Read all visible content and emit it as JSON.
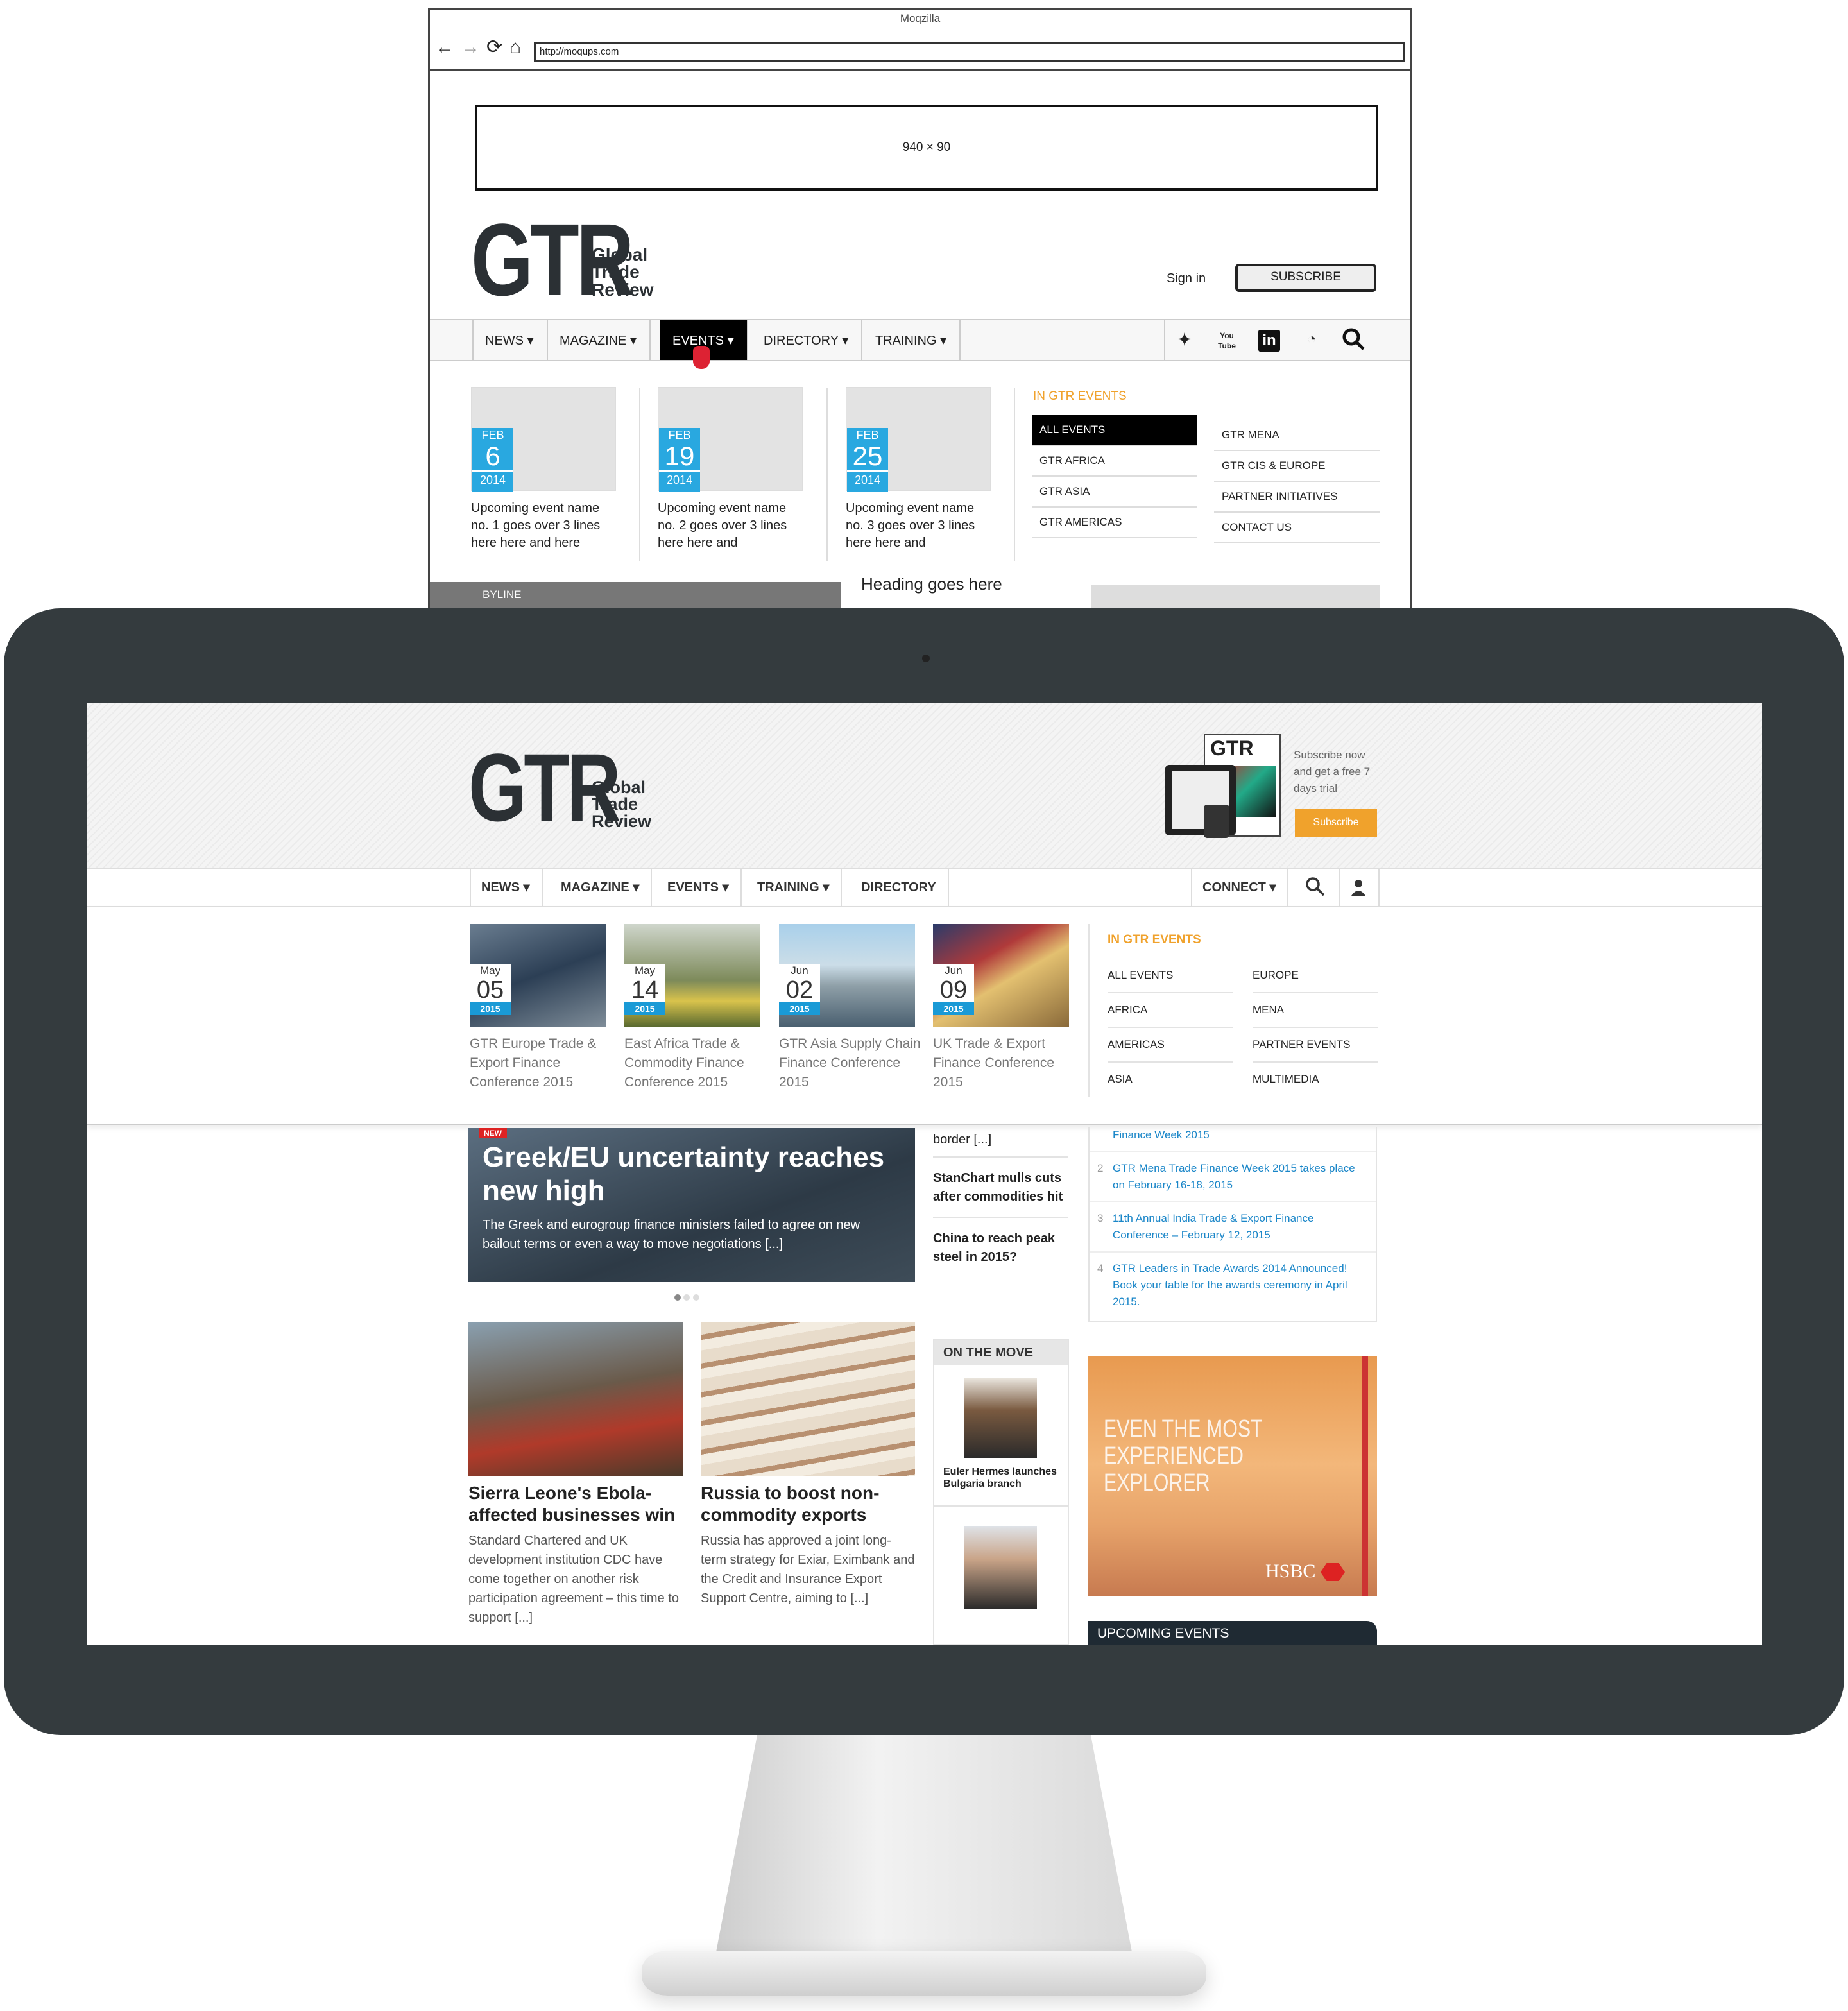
{
  "wireframe": {
    "window_title": "Moqzilla",
    "url": "http://moqups.com",
    "banner_label": "940 × 90",
    "logo": {
      "mark": "GTR",
      "line1": "Global",
      "line2": "Trade",
      "line3": "Review"
    },
    "sign_in": "Sign in",
    "subscribe": "SUBSCRIBE",
    "nav": [
      "NEWS ▾",
      "MAGAZINE ▾",
      "EVENTS ▾",
      "DIRECTORY ▾",
      "TRAINING ▾"
    ],
    "social_icons": [
      "twitter-icon",
      "youtube-icon",
      "linkedin-icon",
      "rss-icon",
      "search-icon"
    ],
    "youtube_label": "You Tube",
    "linkedin_label": "in",
    "cards": [
      {
        "month": "FEB",
        "day": "6",
        "year": "2014",
        "text": "Upcoming event name no. 1 goes over 3 lines here here and here"
      },
      {
        "month": "FEB",
        "day": "19",
        "year": "2014",
        "text": "Upcoming event name no. 2 goes over 3 lines here here and"
      },
      {
        "month": "FEB",
        "day": "25",
        "year": "2014",
        "text": "Upcoming event name no. 3 goes over 3 lines here here and"
      }
    ],
    "section_title": "IN GTR EVENTS",
    "events_col1": [
      "ALL EVENTS",
      "GTR AFRICA",
      "GTR ASIA",
      "GTR AMERICAS"
    ],
    "events_col2": [
      "GTR MENA",
      "GTR CIS & EUROPE",
      "PARTNER INITIATIVES",
      "CONTACT US"
    ],
    "byline": "BYLINE",
    "partial_heading": "Heading goes here"
  },
  "site": {
    "logo": {
      "mark": "GTR",
      "line1": "Global",
      "line2": "Trade",
      "line3": "Review"
    },
    "promo_text": "Subscribe now and get a free 7 days trial",
    "promo_button": "Subscribe",
    "nav": [
      "NEWS ▾",
      "MAGAZINE ▾",
      "EVENTS ▾",
      "TRAINING ▾",
      "DIRECTORY"
    ],
    "connect": "CONNECT ▾",
    "cards": [
      {
        "month": "May",
        "day": "05",
        "year": "2015",
        "text": "GTR Europe Trade & Export Finance Conference 2015"
      },
      {
        "month": "May",
        "day": "14",
        "year": "2015",
        "text": "East Africa Trade & Commodity Finance Conference 2015"
      },
      {
        "month": "Jun",
        "day": "02",
        "year": "2015",
        "text": "GTR Asia Supply Chain Finance Conference 2015"
      },
      {
        "month": "Jun",
        "day": "09",
        "year": "2015",
        "text": "UK Trade & Export Finance Conference 2015"
      }
    ],
    "section_title": "IN GTR EVENTS",
    "events_col1": [
      "ALL EVENTS",
      "AFRICA",
      "AMERICAS",
      "ASIA"
    ],
    "events_col2": [
      "EUROPE",
      "MENA",
      "PARTNER EVENTS",
      "MULTIMEDIA"
    ],
    "hero": {
      "badge": "NEW",
      "title": "Greek/EU uncertainty reaches new high",
      "text": "The Greek and eurogroup finance ministers failed to agree on new bailout terms or even a way to move negotiations [...]"
    },
    "side_stories": [
      {
        "title": "border [...]"
      },
      {
        "title": "StanChart mulls cuts after commodities hit"
      },
      {
        "title": "China to reach peak steel in 2015?"
      }
    ],
    "numbered": [
      {
        "n": "",
        "text": "Finance Week 2015"
      },
      {
        "n": "2",
        "text": "GTR Mena Trade Finance Week 2015 takes place on February 16-18, 2015"
      },
      {
        "n": "3",
        "text": "11th Annual India Trade & Export Finance Conference – February 12, 2015"
      },
      {
        "n": "4",
        "text": "GTR Leaders in Trade Awards 2014 Announced! Book your table for the awards ceremony in April 2015."
      }
    ],
    "stories": [
      {
        "title": "Sierra Leone's Ebola-affected businesses win",
        "text": "Standard Chartered and UK development institution CDC have come together on another risk participation agreement – this time to support [...]"
      },
      {
        "title": "Russia to boost non-commodity exports",
        "text": "Russia has approved a joint long-term strategy for Exiar, Eximbank and the Credit and Insurance Export Support Centre, aiming to [...]"
      }
    ],
    "on_the_move": {
      "title": "ON THE MOVE",
      "caption": "Euler Hermes launches Bulgaria branch"
    },
    "ad": {
      "headline": "EVEN THE MOST EXPERIENCED EXPLORER",
      "brand": "HSBC"
    },
    "upcoming": "UPCOMING EVENTS"
  }
}
